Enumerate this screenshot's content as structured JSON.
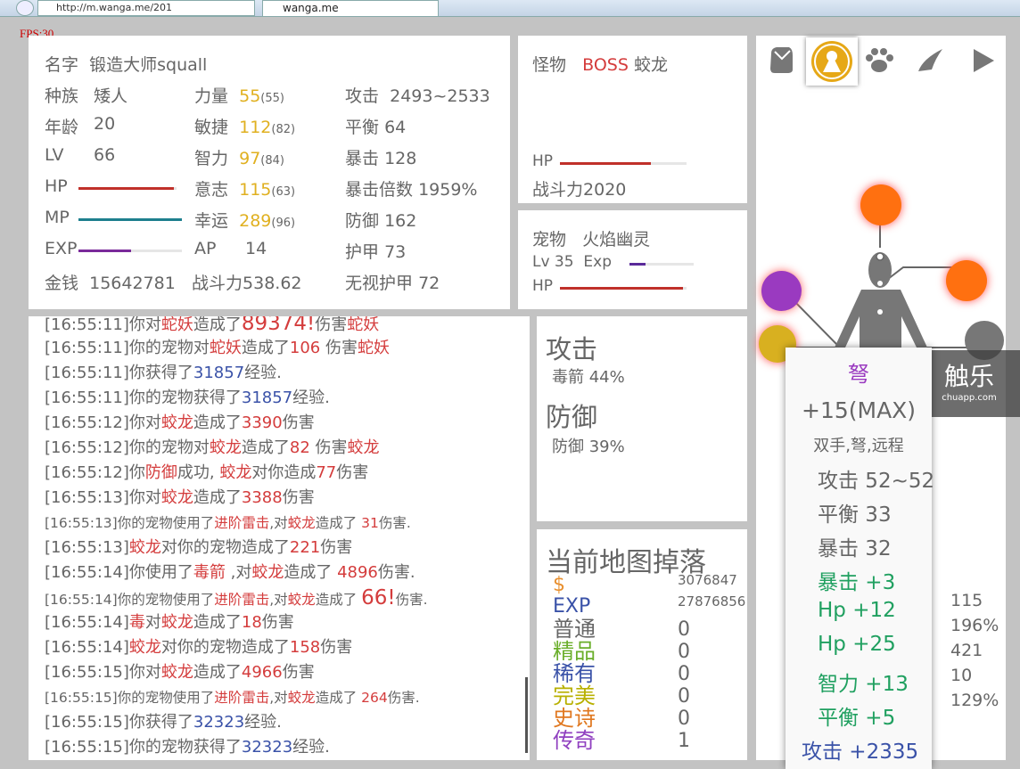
{
  "browser": {
    "url": "http://m.wanga.me/201",
    "tab_title": "wanga.me"
  },
  "fps": "FPS:30",
  "character": {
    "name_label": "名字",
    "name": "锻造大师squall",
    "race_label": "种族",
    "race": "矮人",
    "age_label": "年龄",
    "age": "20",
    "lv_label": "LV",
    "lv": "66",
    "hp_label": "HP",
    "hp_pct": 97,
    "mp_label": "MP",
    "mp_pct": 100,
    "exp_label": "EXP",
    "exp_pct": 51,
    "money_label": "金钱",
    "money": "15642781",
    "str_label": "力量",
    "str": "55",
    "str_base": "(55)",
    "agi_label": "敏捷",
    "agi": "112",
    "agi_base": "(82)",
    "int_label": "智力",
    "int": "97",
    "int_base": "(84)",
    "wil_label": "意志",
    "wil": "115",
    "wil_base": "(63)",
    "luk_label": "幸运",
    "luk": "289",
    "luk_base": "(96)",
    "ap_label": "AP",
    "ap": "14",
    "power_label": "战斗力",
    "power": "538.62",
    "atk_label": "攻击",
    "atk": "2493~2533",
    "bal_label": "平衡",
    "bal": "64",
    "crit_label": "暴击",
    "crit": "128",
    "critmul_label": "暴击倍数",
    "critmul": "1959%",
    "def_label": "防御",
    "def": "162",
    "armor_label": "护甲",
    "armor": "73",
    "ignore_label": "无视护甲",
    "ignore": "72"
  },
  "monster": {
    "label": "怪物",
    "boss": "BOSS",
    "name": "蛟龙",
    "hp_label": "HP",
    "hp_pct": 72,
    "power_label": "战斗力",
    "power": "2020"
  },
  "pet": {
    "label": "宠物",
    "name": "火焰幽灵",
    "lv": "Lv 35",
    "exp_label": "Exp",
    "exp_pct": 25,
    "hp_label": "HP",
    "hp_pct": 97
  },
  "log": [
    {
      "sm": false,
      "segs": [
        [
          "[16:55:11]你对",
          "g"
        ],
        [
          "蛇妖",
          "r"
        ],
        [
          "造成了",
          "g"
        ],
        [
          "89374!",
          "rb"
        ],
        [
          "伤害",
          "g"
        ],
        [
          "蛇妖",
          "r"
        ]
      ]
    },
    {
      "sm": false,
      "segs": [
        [
          "[16:55:11]你的宠物对",
          "g"
        ],
        [
          "蛇妖",
          "r"
        ],
        [
          "造成了",
          "g"
        ],
        [
          "106 ",
          "r"
        ],
        [
          "伤害",
          "g"
        ],
        [
          "蛇妖",
          "r"
        ]
      ]
    },
    {
      "sm": false,
      "segs": [
        [
          "[16:55:11]你获得了",
          "g"
        ],
        [
          "31857",
          "b"
        ],
        [
          "经验.",
          "g"
        ]
      ]
    },
    {
      "sm": false,
      "segs": [
        [
          "[16:55:11]你的宠物获得了",
          "g"
        ],
        [
          "31857",
          "b"
        ],
        [
          "经验.",
          "g"
        ]
      ]
    },
    {
      "sm": false,
      "segs": [
        [
          "[16:55:12]你对",
          "g"
        ],
        [
          "蛟龙",
          "r"
        ],
        [
          "造成了",
          "g"
        ],
        [
          "3390",
          "r"
        ],
        [
          "伤害",
          "g"
        ]
      ]
    },
    {
      "sm": false,
      "segs": [
        [
          "[16:55:12]你的宠物对",
          "g"
        ],
        [
          "蛟龙",
          "r"
        ],
        [
          "造成了",
          "g"
        ],
        [
          "82 ",
          "r"
        ],
        [
          "伤害",
          "g"
        ],
        [
          "蛟龙",
          "r"
        ]
      ]
    },
    {
      "sm": false,
      "segs": [
        [
          "[16:55:12]你",
          "g"
        ],
        [
          "防御",
          "r"
        ],
        [
          "成功, ",
          "g"
        ],
        [
          "蛟龙",
          "r"
        ],
        [
          "对你造成",
          "g"
        ],
        [
          "77",
          "r"
        ],
        [
          "伤害",
          "g"
        ]
      ]
    },
    {
      "sm": false,
      "segs": [
        [
          "[16:55:13]你对",
          "g"
        ],
        [
          "蛟龙",
          "r"
        ],
        [
          "造成了",
          "g"
        ],
        [
          "3388",
          "r"
        ],
        [
          "伤害",
          "g"
        ]
      ]
    },
    {
      "sm": true,
      "segs": [
        [
          "[16:55:13]你的宠物使用了",
          "g"
        ],
        [
          "进阶雷击",
          "r"
        ],
        [
          ",对",
          "g"
        ],
        [
          "蛟龙",
          "r"
        ],
        [
          "造成了 ",
          "g"
        ],
        [
          "31",
          "r"
        ],
        [
          "伤害.",
          "g"
        ]
      ]
    },
    {
      "sm": false,
      "segs": [
        [
          "[16:55:13]",
          "g"
        ],
        [
          "蛟龙",
          "r"
        ],
        [
          "对你的宠物造成了",
          "g"
        ],
        [
          "221",
          "r"
        ],
        [
          "伤害",
          "g"
        ]
      ]
    },
    {
      "sm": false,
      "segs": [
        [
          "[16:55:14]你使用了",
          "g"
        ],
        [
          "毒箭",
          "r"
        ],
        [
          " ,对",
          "g"
        ],
        [
          "蛟龙",
          "r"
        ],
        [
          "造成了 ",
          "g"
        ],
        [
          "4896",
          "r"
        ],
        [
          "伤害.",
          "g"
        ]
      ]
    },
    {
      "sm": true,
      "segs": [
        [
          "[16:55:14]你的宠物使用了",
          "g"
        ],
        [
          "进阶雷击",
          "r"
        ],
        [
          ",对",
          "g"
        ],
        [
          "蛟龙",
          "r"
        ],
        [
          "造成了 ",
          "g"
        ],
        [
          "66!",
          "rb"
        ],
        [
          "伤害.",
          "g"
        ]
      ]
    },
    {
      "sm": false,
      "segs": [
        [
          "[16:55:14]",
          "g"
        ],
        [
          "毒",
          "r"
        ],
        [
          "对",
          "g"
        ],
        [
          "蛟龙",
          "r"
        ],
        [
          "造成了",
          "g"
        ],
        [
          "18",
          "r"
        ],
        [
          "伤害",
          "g"
        ]
      ]
    },
    {
      "sm": false,
      "segs": [
        [
          "[16:55:14]",
          "g"
        ],
        [
          "蛟龙",
          "r"
        ],
        [
          "对你的宠物造成了",
          "g"
        ],
        [
          "158",
          "r"
        ],
        [
          "伤害",
          "g"
        ]
      ]
    },
    {
      "sm": false,
      "segs": [
        [
          "[16:55:15]你对",
          "g"
        ],
        [
          "蛟龙",
          "r"
        ],
        [
          "造成了",
          "g"
        ],
        [
          "4966",
          "r"
        ],
        [
          "伤害",
          "g"
        ]
      ]
    },
    {
      "sm": true,
      "segs": [
        [
          "[16:55:15]你的宠物使用了",
          "g"
        ],
        [
          "进阶雷击",
          "r"
        ],
        [
          ",对",
          "g"
        ],
        [
          "蛟龙",
          "r"
        ],
        [
          "造成了 ",
          "g"
        ],
        [
          "264",
          "r"
        ],
        [
          "伤害.",
          "g"
        ]
      ]
    },
    {
      "sm": false,
      "segs": [
        [
          "[16:55:15]你获得了",
          "g"
        ],
        [
          "32323",
          "b"
        ],
        [
          "经验.",
          "g"
        ]
      ]
    },
    {
      "sm": false,
      "segs": [
        [
          "[16:55:15]你的宠物获得了",
          "g"
        ],
        [
          "32323",
          "b"
        ],
        [
          "经验.",
          "g"
        ]
      ]
    }
  ],
  "skills": {
    "attack_title": "攻击",
    "attack_skill": "毒箭 44%",
    "defense_title": "防御",
    "defense_skill": "防御 39%"
  },
  "drops": {
    "title": "当前地图掉落",
    "money_label": "$",
    "money": "3076847",
    "exp_label": "EXP",
    "exp": "27876856",
    "items": [
      {
        "label": "普通",
        "count": "0",
        "color": "#666666"
      },
      {
        "label": "精品",
        "count": "0",
        "color": "#6aae2a"
      },
      {
        "label": "稀有",
        "count": "0",
        "color": "#3a52a8"
      },
      {
        "label": "完美",
        "count": "0",
        "color": "#b8b000"
      },
      {
        "label": "史诗",
        "count": "0",
        "color": "#e07820"
      },
      {
        "label": "传奇",
        "count": "1",
        "color": "#9040c0"
      }
    ]
  },
  "tooltip": {
    "name": "弩",
    "enhance": "+15(MAX)",
    "type": "双手,弩,远程",
    "base": [
      "攻击 52~52",
      "平衡 33",
      "暴击 32"
    ],
    "bonus": [
      "暴击 +3",
      "Hp +12",
      "Hp +25",
      "智力 +13",
      "平衡 +5"
    ],
    "special": "攻击 +2335"
  },
  "hidden_stats": [
    "115",
    "196%",
    "421",
    "10",
    "129%"
  ],
  "watermark": {
    "text": "触乐",
    "sub": "chuapp.com"
  }
}
